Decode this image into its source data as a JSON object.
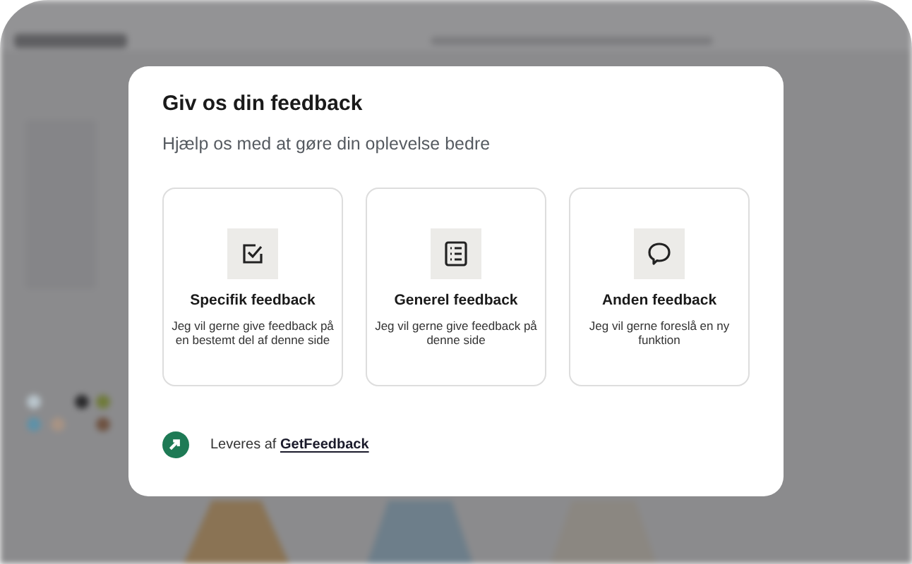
{
  "dialog": {
    "title": "Giv os din feedback",
    "subtitle": "Hjælp os med at gøre din oplevelse bedre",
    "options": [
      {
        "kind": "checkbox",
        "title": "Specifik feedback",
        "description": "Jeg vil gerne give feedback på en bestemt del af denne side"
      },
      {
        "kind": "list",
        "title": "Generel feedback",
        "description": "Jeg vil gerne give feedback på denne side"
      },
      {
        "kind": "speech",
        "title": "Anden feedback",
        "description": "Jeg vil gerne foreslå en ny funktion"
      }
    ],
    "footer": {
      "prefix": "Leveres af",
      "link": "GetFeedback"
    }
  }
}
